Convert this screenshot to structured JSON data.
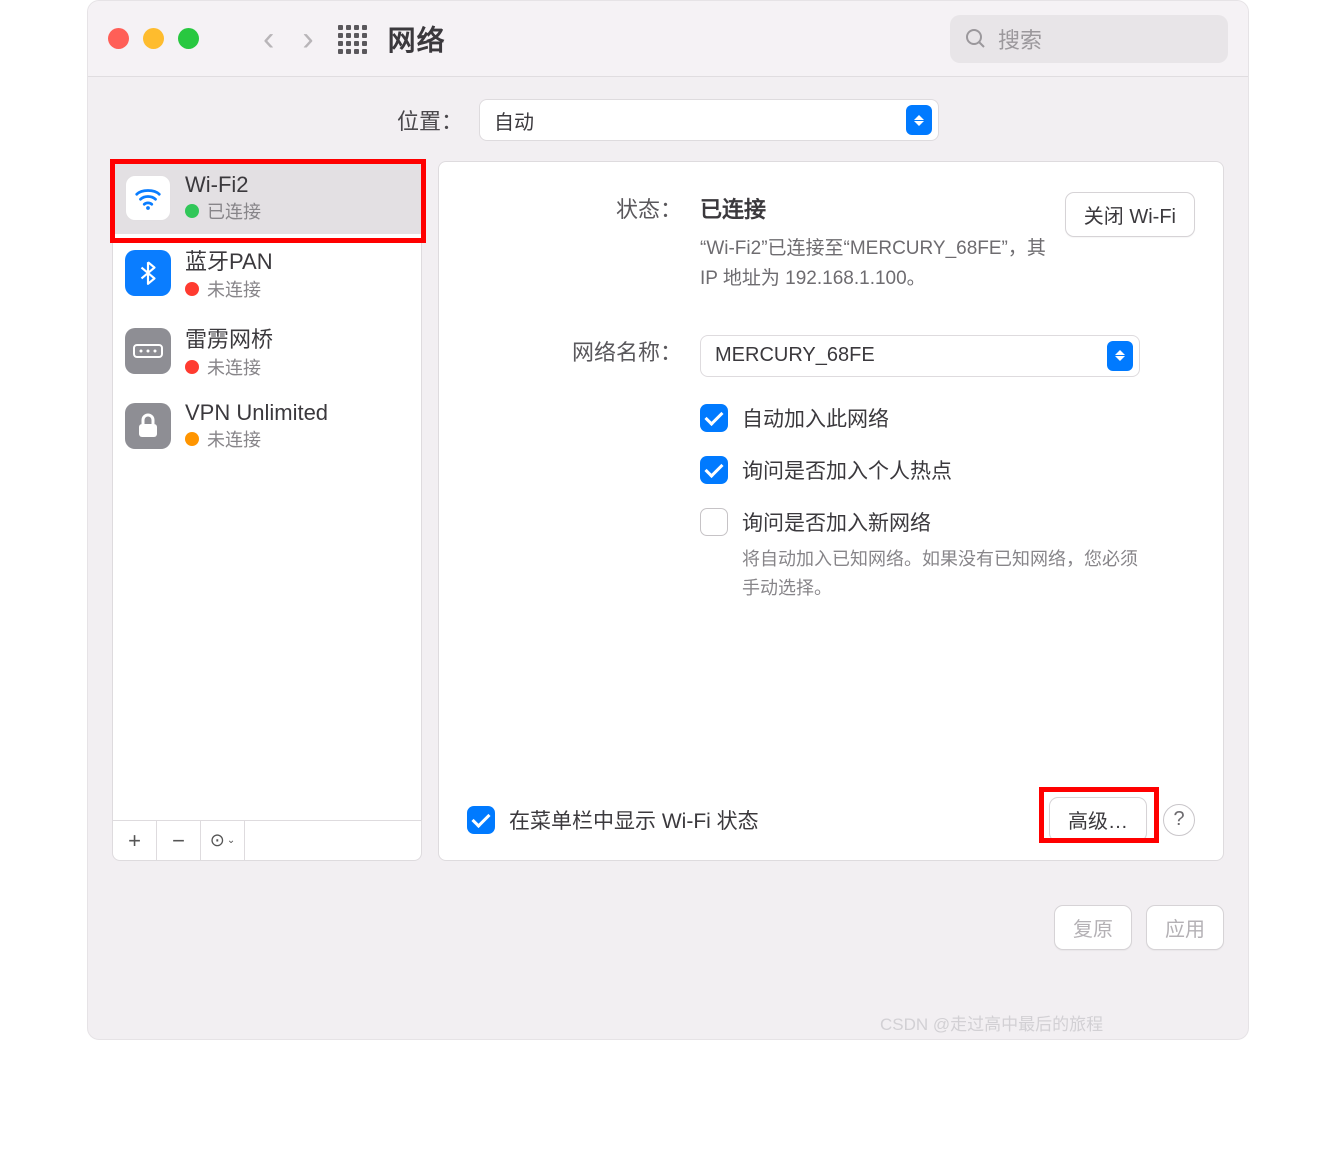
{
  "toolbar": {
    "title": "网络",
    "search_placeholder": "搜索"
  },
  "location": {
    "label": "位置：",
    "value": "自动"
  },
  "sidebar": {
    "items": [
      {
        "name": "Wi-Fi2",
        "status": "已连接",
        "dot": "green",
        "icon": "wifi",
        "selected": true
      },
      {
        "name": "蓝牙PAN",
        "status": "未连接",
        "dot": "red",
        "icon": "bluetooth",
        "selected": false
      },
      {
        "name": "雷雳网桥",
        "status": "未连接",
        "dot": "red",
        "icon": "bridge",
        "selected": false
      },
      {
        "name": "VPN Unlimited",
        "status": "未连接",
        "dot": "orange",
        "icon": "vpn",
        "selected": false
      }
    ],
    "footer": {
      "add": "+",
      "remove": "−",
      "more": "⊙"
    }
  },
  "detail": {
    "status_label": "状态：",
    "status_value": "已连接",
    "turn_off": "关闭 Wi-Fi",
    "status_desc": "“Wi-Fi2”已连接至“MERCURY_68FE”，其 IP 地址为 192.168.1.100。",
    "network_label": "网络名称：",
    "network_value": "MERCURY_68FE",
    "check_auto_join": "自动加入此网络",
    "check_ask_hotspot": "询问是否加入个人热点",
    "check_ask_new": "询问是否加入新网络",
    "ask_new_desc": "将自动加入已知网络。如果没有已知网络，您必须手动选择。",
    "show_menu": "在菜单栏中显示 Wi-Fi 状态",
    "advanced": "高级…",
    "help": "?"
  },
  "footer": {
    "revert": "复原",
    "apply": "应用"
  },
  "watermark": "CSDN @走过高中最后的旅程"
}
